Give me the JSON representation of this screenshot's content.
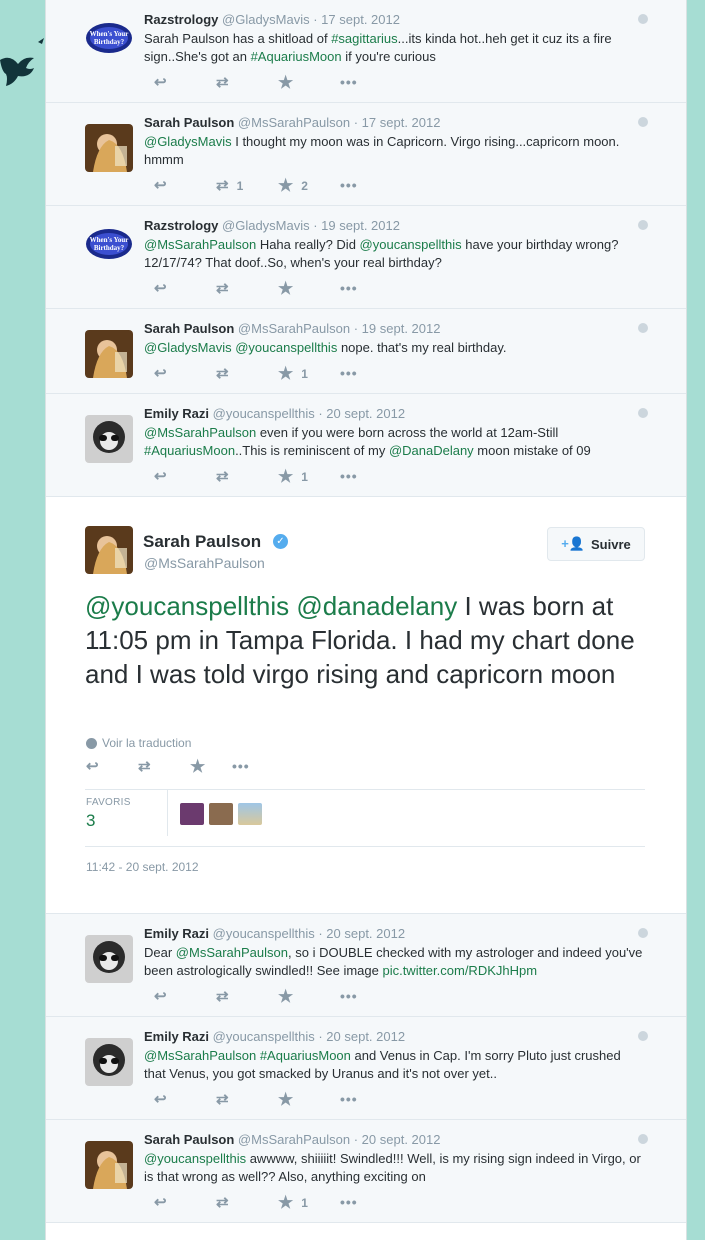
{
  "tweets_before": [
    {
      "name": "Razstrology",
      "handle": "@GladysMavis",
      "date": "· 17 sept. 2012",
      "avatar": "logo",
      "avatar_text": "When's Your Birthday?",
      "text": [
        {
          "t": "Sarah Paulson has a shitload of "
        },
        {
          "t": "#sagittarius",
          "l": true
        },
        {
          "t": "...its kinda hot..heh get it cuz its a fire sign..She's got an "
        },
        {
          "t": "#AquariusMoon",
          "l": true
        },
        {
          "t": " if you're curious"
        }
      ],
      "retweets": "",
      "favorites": ""
    },
    {
      "name": "Sarah Paulson",
      "handle": "@MsSarahPaulson",
      "date": "· 17 sept. 2012",
      "avatar": "sarah",
      "text": [
        {
          "t": "@GladysMavis",
          "l": true
        },
        {
          "t": " I thought my moon was in Capricorn. Virgo rising...capricorn moon. hmmm"
        }
      ],
      "retweets": "1",
      "favorites": "2"
    },
    {
      "name": "Razstrology",
      "handle": "@GladysMavis",
      "date": "· 19 sept. 2012",
      "avatar": "logo",
      "avatar_text": "When's Your Birthday?",
      "text": [
        {
          "t": "@MsSarahPaulson",
          "l": true
        },
        {
          "t": " Haha really? Did "
        },
        {
          "t": "@youcanspellthis",
          "l": true
        },
        {
          "t": " have your birthday wrong? 12/17/74? That doof..So, when's your real birthday?"
        }
      ],
      "retweets": "",
      "favorites": ""
    },
    {
      "name": "Sarah Paulson",
      "handle": "@MsSarahPaulson",
      "date": "· 19 sept. 2012",
      "avatar": "sarah",
      "text": [
        {
          "t": "@GladysMavis",
          "l": true
        },
        {
          "t": " "
        },
        {
          "t": "@youcanspellthis",
          "l": true
        },
        {
          "t": " nope. that's my real birthday."
        }
      ],
      "retweets": "",
      "favorites": "1"
    },
    {
      "name": "Emily Razi",
      "handle": "@youcanspellthis",
      "date": "· 20 sept. 2012",
      "avatar": "emily",
      "text": [
        {
          "t": "@MsSarahPaulson",
          "l": true
        },
        {
          "t": " even if you were born across the world at 12am-Still "
        },
        {
          "t": "#AquariusMoon",
          "l": true
        },
        {
          "t": "..This is reminiscent of my "
        },
        {
          "t": "@DanaDelany",
          "l": true
        },
        {
          "t": " moon mistake of 09"
        }
      ],
      "retweets": "",
      "favorites": "1"
    }
  ],
  "main_tweet": {
    "name": "Sarah Paulson",
    "handle": "@MsSarahPaulson",
    "verified_icon": "verified-check-icon",
    "follow_label": "Suivre",
    "text": [
      {
        "t": "@youcanspellthis",
        "l": true
      },
      {
        "t": " "
      },
      {
        "t": "@danadelany",
        "l": true
      },
      {
        "t": " I was born at 11:05 pm in Tampa Florida. I had my chart done and I was told virgo rising and capricorn moon"
      }
    ],
    "translate_label": "Voir la traduction",
    "favorites_label": "FAVORIS",
    "favorites_count": "3",
    "timestamp": "11:42 - 20 sept. 2012"
  },
  "tweets_after": [
    {
      "name": "Emily Razi",
      "handle": "@youcanspellthis",
      "date": "· 20 sept. 2012",
      "avatar": "emily",
      "text": [
        {
          "t": "Dear "
        },
        {
          "t": "@MsSarahPaulson",
          "l": true
        },
        {
          "t": ", so i DOUBLE checked with my astrologer and indeed you've been astrologically swindled!! See image "
        },
        {
          "t": "pic.twitter.com/RDKJhHpm",
          "l": true
        }
      ],
      "retweets": "",
      "favorites": ""
    },
    {
      "name": "Emily Razi",
      "handle": "@youcanspellthis",
      "date": "· 20 sept. 2012",
      "avatar": "emily",
      "text": [
        {
          "t": "@MsSarahPaulson",
          "l": true
        },
        {
          "t": " "
        },
        {
          "t": "#AquariusMoon",
          "l": true
        },
        {
          "t": " and Venus in Cap. I'm sorry Pluto just crushed that Venus, you got smacked by Uranus and it's not over yet.."
        }
      ],
      "retweets": "",
      "favorites": ""
    },
    {
      "name": "Sarah Paulson",
      "handle": "@MsSarahPaulson",
      "date": "· 20 sept. 2012",
      "avatar": "sarah",
      "text": [
        {
          "t": "@youcanspellthis",
          "l": true
        },
        {
          "t": " awwww, shiiiiit! Swindled!!! Well, is my rising sign indeed in Virgo, or is that wrong as well?? Also, anything exciting on"
        }
      ],
      "retweets": "",
      "favorites": "1"
    }
  ],
  "colors": {
    "background": "#a6ddd3",
    "link": "#1b7c4a",
    "muted": "#8899a6",
    "tweet_bg": "#f5f8fa"
  }
}
